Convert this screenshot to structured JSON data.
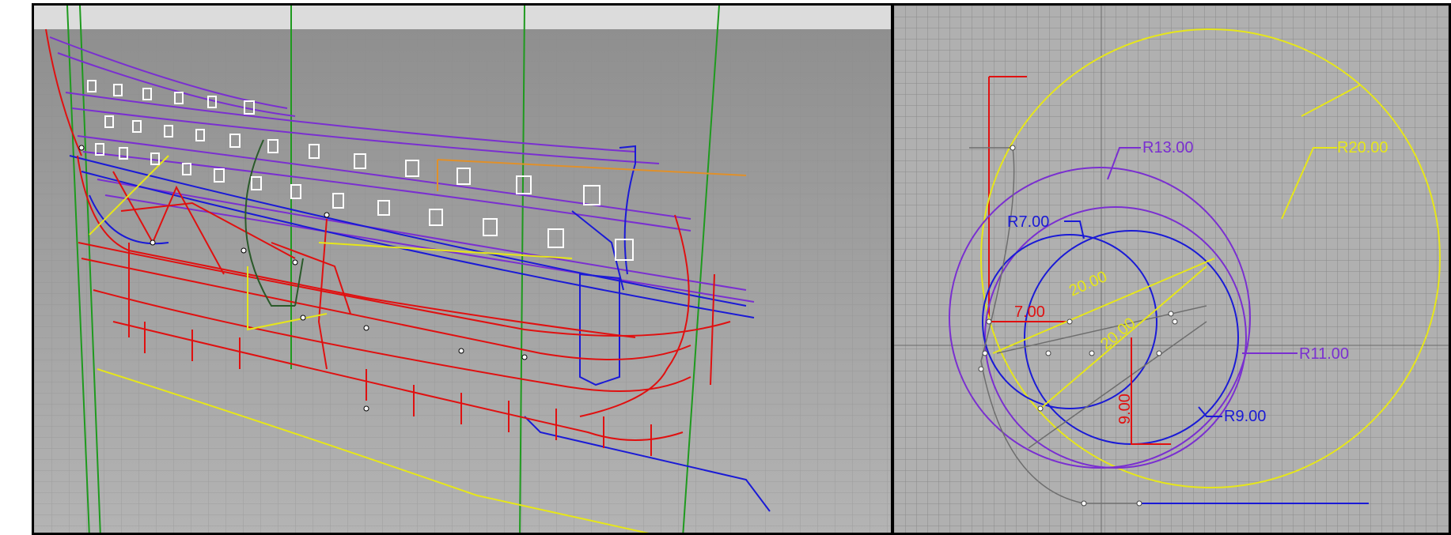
{
  "app": {
    "viewports": [
      "perspective",
      "top"
    ],
    "colors": {
      "background_grid": "#a9a9a9",
      "grid_line": "#8e8e8e",
      "red_curves": "#e01010",
      "purple_curves": "#7a2fd0",
      "blue_curves": "#1a1ad6",
      "green_lines": "#1e9a1e",
      "yellow_lines": "#e6e61a",
      "orange_lines": "#e0902a"
    }
  },
  "top_view": {
    "dimensions": {
      "r13": "R13.00",
      "r20": "R20.00",
      "r7": "R7.00",
      "r11": "R11.00",
      "r9": "R9.00",
      "d7": "7.00",
      "d20a": "20.00",
      "d20b": "20.00",
      "d9": "9.00"
    }
  }
}
